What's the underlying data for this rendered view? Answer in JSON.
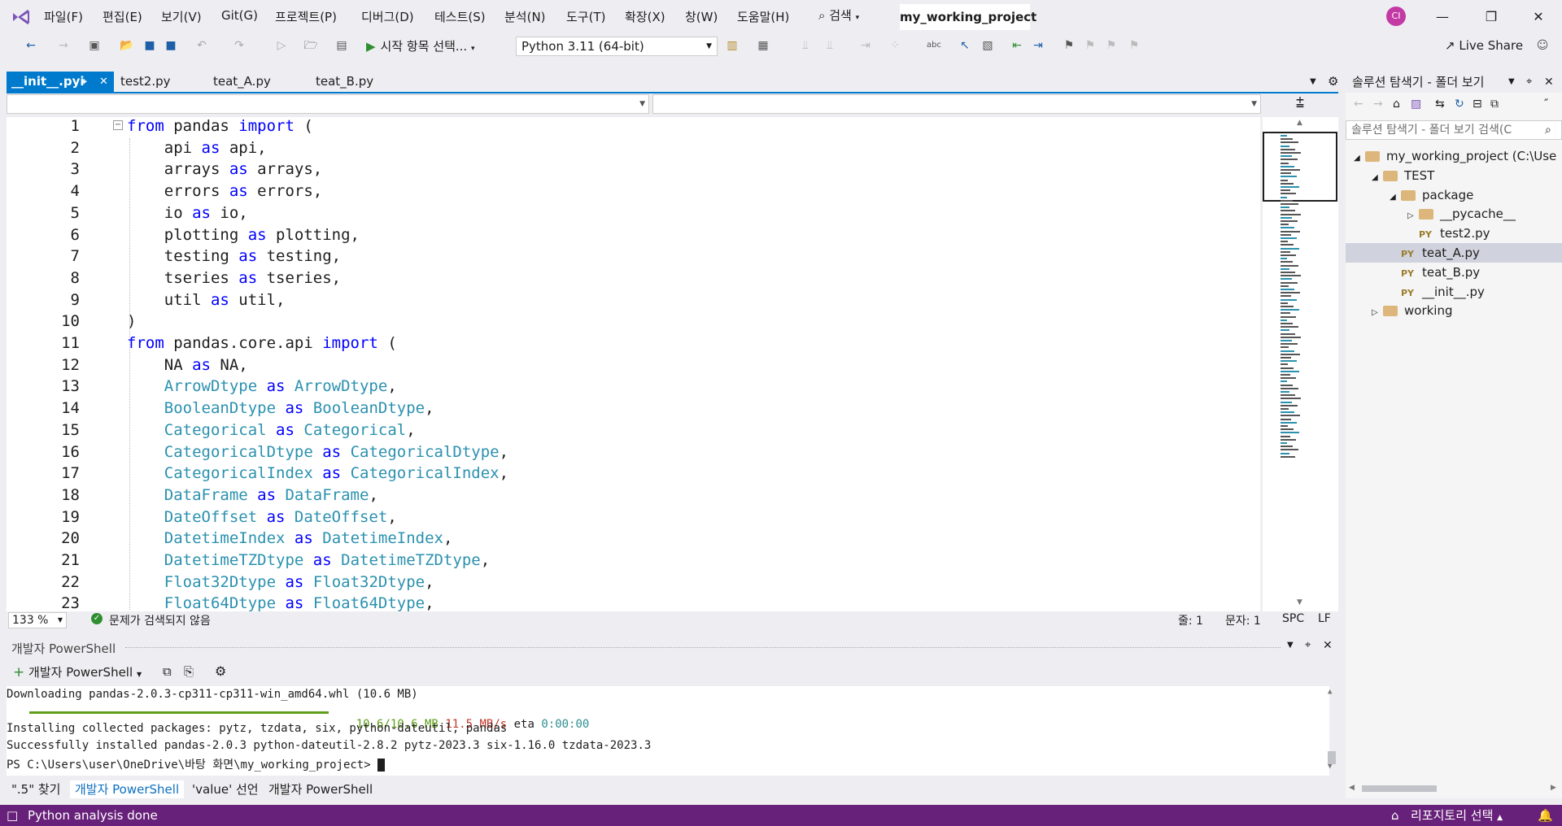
{
  "menu": {
    "items": [
      "파일(F)",
      "편집(E)",
      "보기(V)",
      "Git(G)",
      "프로젝트(P)",
      "디버그(D)",
      "테스트(S)",
      "분석(N)",
      "도구(T)",
      "확장(X)",
      "창(W)",
      "도움말(H)"
    ],
    "search_label": "검색",
    "project_name": "my_working_project",
    "avatar_initials": "CI"
  },
  "toolbar": {
    "start_label": "시작 항목 선택...",
    "python_env": "Python 3.11 (64-bit)",
    "live_share": "Live Share"
  },
  "tabs": [
    {
      "label": "__init__.pyi",
      "active": true
    },
    {
      "label": "test2.py",
      "active": false
    },
    {
      "label": "teat_A.py",
      "active": false
    },
    {
      "label": "teat_B.py",
      "active": false
    }
  ],
  "editor": {
    "line_numbers": [
      "1",
      "2",
      "3",
      "4",
      "5",
      "6",
      "7",
      "8",
      "9",
      "10",
      "11",
      "12",
      "13",
      "14",
      "15",
      "16",
      "17",
      "18",
      "19",
      "20",
      "21",
      "22",
      "23"
    ],
    "lines": [
      [
        {
          "t": "from",
          "c": "kw"
        },
        {
          "t": " pandas ",
          "c": "plain"
        },
        {
          "t": "import",
          "c": "kw"
        },
        {
          "t": " (",
          "c": "plain"
        }
      ],
      [
        {
          "t": "    api ",
          "c": "plain"
        },
        {
          "t": "as",
          "c": "kw"
        },
        {
          "t": " api,",
          "c": "plain"
        }
      ],
      [
        {
          "t": "    arrays ",
          "c": "plain"
        },
        {
          "t": "as",
          "c": "kw"
        },
        {
          "t": " arrays,",
          "c": "plain"
        }
      ],
      [
        {
          "t": "    errors ",
          "c": "plain"
        },
        {
          "t": "as",
          "c": "kw"
        },
        {
          "t": " errors,",
          "c": "plain"
        }
      ],
      [
        {
          "t": "    io ",
          "c": "plain"
        },
        {
          "t": "as",
          "c": "kw"
        },
        {
          "t": " io,",
          "c": "plain"
        }
      ],
      [
        {
          "t": "    plotting ",
          "c": "plain"
        },
        {
          "t": "as",
          "c": "kw"
        },
        {
          "t": " plotting,",
          "c": "plain"
        }
      ],
      [
        {
          "t": "    testing ",
          "c": "plain"
        },
        {
          "t": "as",
          "c": "kw"
        },
        {
          "t": " testing,",
          "c": "plain"
        }
      ],
      [
        {
          "t": "    tseries ",
          "c": "plain"
        },
        {
          "t": "as",
          "c": "kw"
        },
        {
          "t": " tseries,",
          "c": "plain"
        }
      ],
      [
        {
          "t": "    util ",
          "c": "plain"
        },
        {
          "t": "as",
          "c": "kw"
        },
        {
          "t": " util,",
          "c": "plain"
        }
      ],
      [
        {
          "t": ")",
          "c": "plain"
        }
      ],
      [
        {
          "t": "from",
          "c": "kw"
        },
        {
          "t": " pandas.core.api ",
          "c": "plain"
        },
        {
          "t": "import",
          "c": "kw"
        },
        {
          "t": " (",
          "c": "plain"
        }
      ],
      [
        {
          "t": "    NA ",
          "c": "plain"
        },
        {
          "t": "as",
          "c": "kw"
        },
        {
          "t": " NA,",
          "c": "plain"
        }
      ],
      [
        {
          "t": "    ",
          "c": "plain"
        },
        {
          "t": "ArrowDtype",
          "c": "ty"
        },
        {
          "t": " as ",
          "c": "kw"
        },
        {
          "t": "ArrowDtype",
          "c": "ty"
        },
        {
          "t": ",",
          "c": "plain"
        }
      ],
      [
        {
          "t": "    ",
          "c": "plain"
        },
        {
          "t": "BooleanDtype",
          "c": "ty"
        },
        {
          "t": " as ",
          "c": "kw"
        },
        {
          "t": "BooleanDtype",
          "c": "ty"
        },
        {
          "t": ",",
          "c": "plain"
        }
      ],
      [
        {
          "t": "    ",
          "c": "plain"
        },
        {
          "t": "Categorical",
          "c": "ty"
        },
        {
          "t": " as ",
          "c": "kw"
        },
        {
          "t": "Categorical",
          "c": "ty"
        },
        {
          "t": ",",
          "c": "plain"
        }
      ],
      [
        {
          "t": "    ",
          "c": "plain"
        },
        {
          "t": "CategoricalDtype",
          "c": "ty"
        },
        {
          "t": " as ",
          "c": "kw"
        },
        {
          "t": "CategoricalDtype",
          "c": "ty"
        },
        {
          "t": ",",
          "c": "plain"
        }
      ],
      [
        {
          "t": "    ",
          "c": "plain"
        },
        {
          "t": "CategoricalIndex",
          "c": "ty"
        },
        {
          "t": " as ",
          "c": "kw"
        },
        {
          "t": "CategoricalIndex",
          "c": "ty"
        },
        {
          "t": ",",
          "c": "plain"
        }
      ],
      [
        {
          "t": "    ",
          "c": "plain"
        },
        {
          "t": "DataFrame",
          "c": "ty"
        },
        {
          "t": " as ",
          "c": "kw"
        },
        {
          "t": "DataFrame",
          "c": "ty"
        },
        {
          "t": ",",
          "c": "plain"
        }
      ],
      [
        {
          "t": "    ",
          "c": "plain"
        },
        {
          "t": "DateOffset",
          "c": "ty"
        },
        {
          "t": " as ",
          "c": "kw"
        },
        {
          "t": "DateOffset",
          "c": "ty"
        },
        {
          "t": ",",
          "c": "plain"
        }
      ],
      [
        {
          "t": "    ",
          "c": "plain"
        },
        {
          "t": "DatetimeIndex",
          "c": "ty"
        },
        {
          "t": " as ",
          "c": "kw"
        },
        {
          "t": "DatetimeIndex",
          "c": "ty"
        },
        {
          "t": ",",
          "c": "plain"
        }
      ],
      [
        {
          "t": "    ",
          "c": "plain"
        },
        {
          "t": "DatetimeTZDtype",
          "c": "ty"
        },
        {
          "t": " as ",
          "c": "kw"
        },
        {
          "t": "DatetimeTZDtype",
          "c": "ty"
        },
        {
          "t": ",",
          "c": "plain"
        }
      ],
      [
        {
          "t": "    ",
          "c": "plain"
        },
        {
          "t": "Float32Dtype",
          "c": "ty"
        },
        {
          "t": " as ",
          "c": "kw"
        },
        {
          "t": "Float32Dtype",
          "c": "ty"
        },
        {
          "t": ",",
          "c": "plain"
        }
      ],
      [
        {
          "t": "    ",
          "c": "plain"
        },
        {
          "t": "Float64Dtype",
          "c": "ty"
        },
        {
          "t": " as ",
          "c": "kw"
        },
        {
          "t": "Float64Dtype",
          "c": "ty"
        },
        {
          "t": ",",
          "c": "plain"
        }
      ]
    ]
  },
  "editor_status": {
    "zoom": "133 %",
    "issues": "문제가 검색되지 않음",
    "line": "줄: 1",
    "col": "문자: 1",
    "spacing": "SPC",
    "eol": "LF"
  },
  "terminal": {
    "title": "개발자 PowerShell",
    "new_terminal_label": "개발자 PowerShell",
    "line1": "Downloading pandas-2.0.3-cp311-cp311-win_amd64.whl (10.6 MB)",
    "progress_size": "10.6/10.6 MB",
    "progress_speed": "11.5 MB/s",
    "progress_eta_label": "eta",
    "progress_eta": "0:00:00",
    "progress_fraction": 1.0,
    "line3": "Installing collected packages: pytz, tzdata, six, python-dateutil, pandas",
    "line4": "Successfully installed pandas-2.0.3 python-dateutil-2.8.2 pytz-2023.3 six-1.16.0 tzdata-2023.3",
    "prompt": "PS C:\\Users\\user\\OneDrive\\바탕 화면\\my_working_project>"
  },
  "bottom_tabs": [
    {
      "label": "\".5\" 찾기",
      "active": false
    },
    {
      "label": "개발자 PowerShell",
      "active": true
    },
    {
      "label": "'value' 선언",
      "active": false
    },
    {
      "label": "개발자 PowerShell",
      "active": false
    }
  ],
  "solution_explorer": {
    "title": "솔루션 탐색기 - 폴더 보기",
    "search_placeholder": "솔루션 탐색기 - 폴더 보기 검색(C",
    "tree": [
      {
        "label": "my_working_project (C:\\Use",
        "kind": "folder",
        "depth": 0,
        "expanded": true
      },
      {
        "label": "TEST",
        "kind": "folder",
        "depth": 1,
        "expanded": true
      },
      {
        "label": "package",
        "kind": "folder",
        "depth": 2,
        "expanded": true
      },
      {
        "label": "__pycache__",
        "kind": "folder",
        "depth": 3,
        "expanded": false
      },
      {
        "label": "test2.py",
        "kind": "py",
        "depth": 3
      },
      {
        "label": "teat_A.py",
        "kind": "py",
        "depth": 2,
        "selected": true
      },
      {
        "label": "teat_B.py",
        "kind": "py",
        "depth": 2
      },
      {
        "label": "__init__.py",
        "kind": "py",
        "depth": 2
      },
      {
        "label": "working",
        "kind": "folder",
        "depth": 1,
        "expanded": false
      }
    ]
  },
  "statusbar": {
    "left": "Python analysis done",
    "repo": "리포지토리 선택"
  },
  "colors": {
    "accent": "#007acc",
    "statusbar": "#68217a",
    "keyword": "#0000ff",
    "type": "#2b91af",
    "progress": "#5f9e1b",
    "speed": "#c0392b",
    "eta": "#2f8e8e"
  }
}
